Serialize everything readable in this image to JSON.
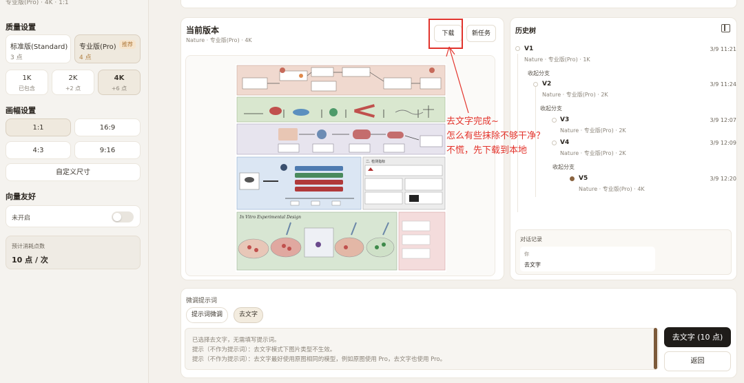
{
  "left": {
    "crumb": "专业版(Pro) · 4K · 1:1",
    "quality_title": "质量设置",
    "quality": [
      {
        "name": "标准版(Standard)",
        "cost": "3 点"
      },
      {
        "name": "专业版(Pro)",
        "cost": "4 点",
        "badge": "推荐",
        "selected": true
      }
    ],
    "resolution": [
      {
        "label": "1K",
        "sub": "已包含"
      },
      {
        "label": "2K",
        "sub": "+2 点"
      },
      {
        "label": "4K",
        "sub": "+6 点",
        "selected": true
      }
    ],
    "aspect_title": "画幅设置",
    "aspect": [
      "1:1",
      "16:9",
      "4:3",
      "9:16"
    ],
    "aspect_selected": "1:1",
    "custom_size": "自定义尺寸",
    "vector_title": "向量友好",
    "vector_state": "未开启",
    "cost_label": "预计消耗点数",
    "cost_value": "10 点 / 次"
  },
  "main": {
    "title": "当前版本",
    "subtitle": "Nature · 专业版(Pro) · 4K",
    "download": "下载",
    "new_task": "新任务",
    "figure_section": "In Vitro Experimental Design",
    "figure_panel": "二. 检测指标"
  },
  "history": {
    "title": "历史树",
    "versions": [
      {
        "name": "V1",
        "meta": "Nature · 专业版(Pro) · 1K",
        "time": "3/9 11:21"
      },
      {
        "branch": "收起分支"
      },
      {
        "name": "V2",
        "meta": "Nature · 专业版(Pro) · 2K",
        "time": "3/9 11:24"
      },
      {
        "branch": "收起分支"
      },
      {
        "name": "V3",
        "meta": "Nature · 专业版(Pro) · 2K",
        "time": "3/9 12:07"
      },
      {
        "name": "V4",
        "meta": "Nature · 专业版(Pro) · 2K",
        "time": "3/9 12:09"
      },
      {
        "branch": "收起分支"
      },
      {
        "name": "V5",
        "meta": "Nature · 专业版(Pro) · 4K",
        "time": "3/9 12:20",
        "current": true
      }
    ],
    "chat_label": "对话记录",
    "chat_who": "你",
    "chat_msg": "去文字"
  },
  "prompt": {
    "label": "微调提示词",
    "chips": [
      "提示词微调",
      "去文字"
    ],
    "chip_selected": "去文字",
    "lines": [
      "已选择去文字，无需填写提示词。",
      "提示（不作为提示词）：去文字模式下图片类型不生效。",
      "提示（不作为提示词）：去文字最好使用原图相同的模型，例如原图使用 Pro，去文字也使用 Pro。"
    ],
    "primary": "去文字 (10 点)",
    "back": "返回"
  },
  "annotation": {
    "lines": [
      "去文字完成~",
      "怎么有些抹除不够干净？",
      "不慌，先下载到本地"
    ],
    "color": "#e3332b"
  }
}
